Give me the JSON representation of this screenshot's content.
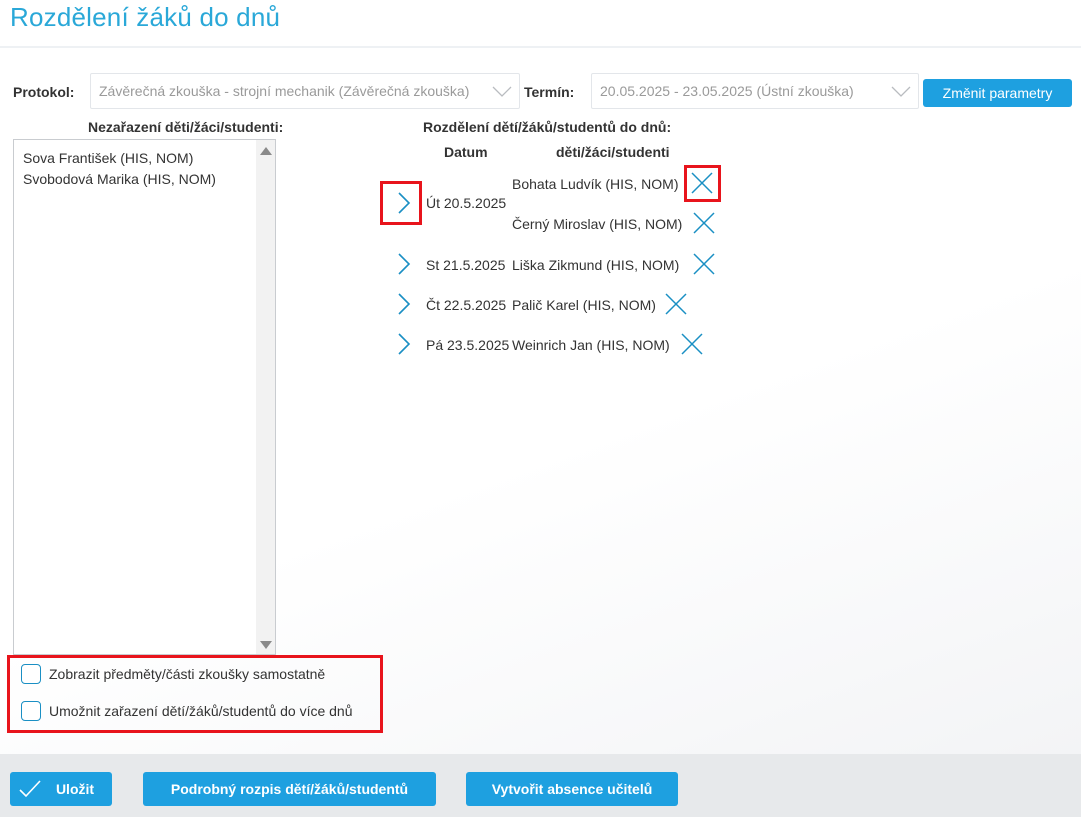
{
  "page": {
    "title": "Rozdělení žáků do dnů"
  },
  "params": {
    "protocol_label": "Protokol:",
    "protocol_value": "Závěrečná zkouška - strojní mechanik (Závěrečná zkouška)",
    "term_label": "Termín:",
    "term_value": "20.05.2025 - 23.05.2025 (Ústní zkouška)",
    "change_button": "Změnit parametry"
  },
  "unassigned": {
    "heading": "Nezařazení děti/žáci/studenti:",
    "items": [
      "Sova František (HIS, NOM)",
      "Svobodová Marika (HIS, NOM)"
    ]
  },
  "distribution": {
    "heading": "Rozdělení dětí/žáků/studentů do dnů:",
    "col_date": "Datum",
    "col_students": "děti/žáci/studenti",
    "days": [
      {
        "date": "Út 20.5.2025",
        "students": [
          "Bohata Ludvík (HIS, NOM)",
          "Černý Miroslav (HIS, NOM)"
        ]
      },
      {
        "date": "St 21.5.2025",
        "students": [
          "Liška Zikmund (HIS, NOM)"
        ]
      },
      {
        "date": "Čt 22.5.2025",
        "students": [
          "Palič Karel (HIS, NOM)"
        ]
      },
      {
        "date": "Pá 23.5.2025",
        "students": [
          "Weinrich Jan (HIS, NOM)"
        ]
      }
    ]
  },
  "options": {
    "show_subjects": "Zobrazit předměty/části zkoušky samostatně",
    "allow_multiple_days": "Umožnit zařazení dětí/žáků/studentů do více dnů"
  },
  "footer": {
    "save": "Uložit",
    "detail": "Podrobný rozpis dětí/žáků/studentů",
    "absence": "Vytvořit absence učitelů"
  },
  "colors": {
    "accent": "#1ea0e0",
    "title": "#2aa8d8",
    "highlight": "#e8141c"
  }
}
